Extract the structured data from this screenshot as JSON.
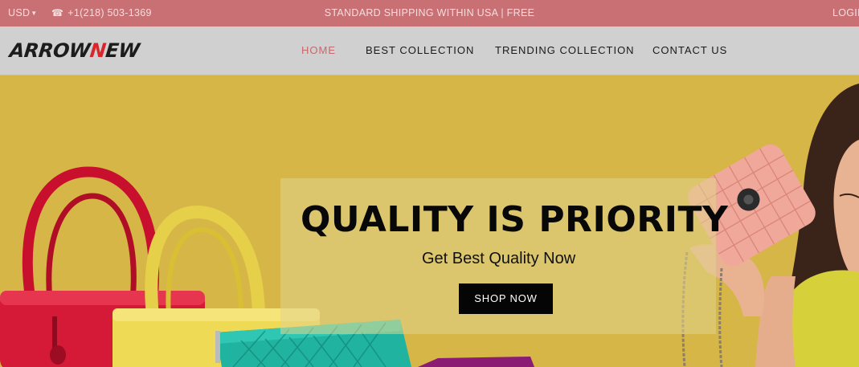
{
  "topbar": {
    "currency": "USD",
    "phone": "+1(218) 503-1369",
    "shipping": "STANDARD SHIPPING WITHIN USA | FREE",
    "login": "LOGIN"
  },
  "brand": {
    "logo_part1": "ARROW",
    "logo_accent": "N",
    "logo_part2": "EW",
    "accent_color": "#d8262c"
  },
  "nav": {
    "items": [
      {
        "label": "HOME",
        "active": true
      },
      {
        "label": "BEST COLLECTION",
        "active": false
      },
      {
        "label": "TRENDING COLLECTION",
        "active": false
      },
      {
        "label": "CONTACT US",
        "active": false
      }
    ]
  },
  "hero": {
    "headline": "QUALITY IS PRIORITY",
    "subheadline": "Get Best Quality Now",
    "cta_label": "SHOP NOW"
  },
  "colors": {
    "topbar": "#c97074",
    "navbar": "#d0d0d0",
    "hero_background": "#d6b647",
    "active_nav": "#c46a6e"
  },
  "icons": {
    "currency_caret": "chevron-down-icon",
    "phone": "phone-icon"
  }
}
